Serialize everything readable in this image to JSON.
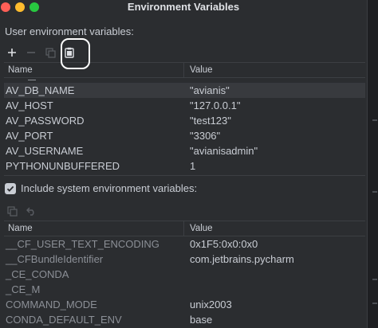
{
  "window": {
    "title": "Environment Variables"
  },
  "user_section": {
    "label": "User environment variables:",
    "toolbar": {
      "add_icon": "plus-icon",
      "remove_icon": "minus-icon",
      "copy_icon": "copy-icon",
      "paste_icon": "clipboard-icon"
    },
    "columns": [
      "Name",
      "Value"
    ],
    "rows": [
      {
        "name": "AV_DB_NAME",
        "value": "\"avianis\""
      },
      {
        "name": "AV_HOST",
        "value": "\"127.0.0.1\""
      },
      {
        "name": "AV_PASSWORD",
        "value": "\"test123\""
      },
      {
        "name": "AV_PORT",
        "value": "\"3306\""
      },
      {
        "name": "AV_USERNAME",
        "value": "\"avianisadmin\""
      },
      {
        "name": "PYTHONUNBUFFERED",
        "value": "1"
      }
    ]
  },
  "system_section": {
    "checkbox_label": "Include system environment variables:",
    "checked": true,
    "toolbar": {
      "copy_icon": "copy-icon",
      "undo_icon": "undo-icon"
    },
    "columns": [
      "Name",
      "Value"
    ],
    "rows": [
      {
        "name": "__CF_USER_TEXT_ENCODING",
        "value": "0x1F5:0x0:0x0"
      },
      {
        "name": "__CFBundleIdentifier",
        "value": "com.jetbrains.pycharm"
      },
      {
        "name": "_CE_CONDA",
        "value": ""
      },
      {
        "name": "_CE_M",
        "value": ""
      },
      {
        "name": "COMMAND_MODE",
        "value": "unix2003"
      },
      {
        "name": "CONDA_DEFAULT_ENV",
        "value": "base"
      }
    ]
  },
  "colors": {
    "background": "#2b2d30",
    "selected_row": "#383a3e",
    "highlight_ring": "#ffffff"
  }
}
